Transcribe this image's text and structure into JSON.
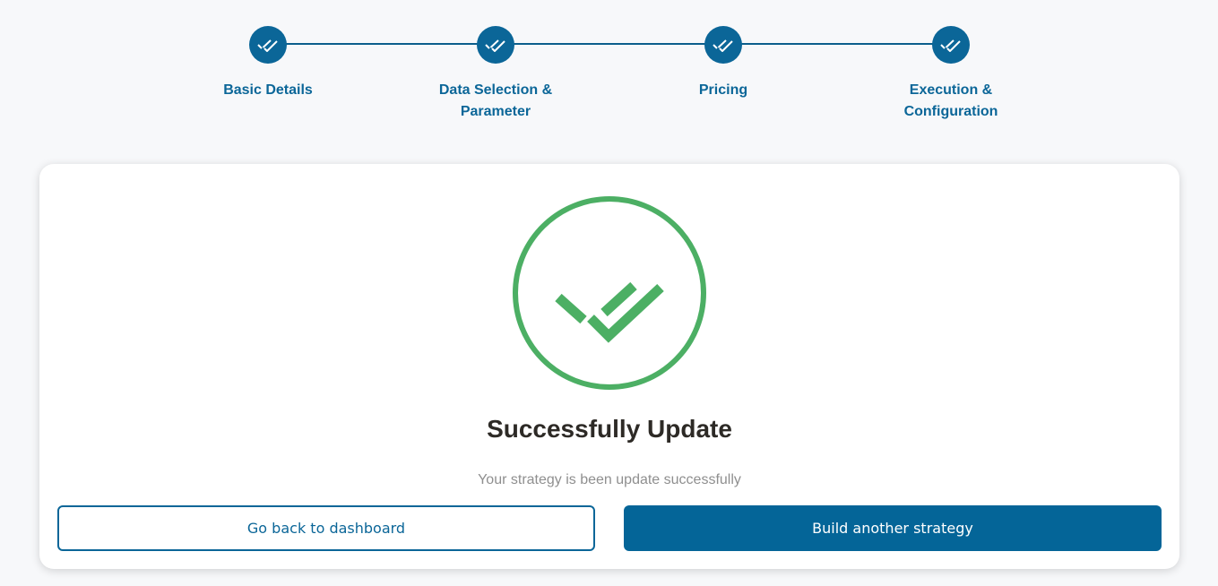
{
  "stepper": {
    "steps": [
      {
        "label_line1": "Basic Details",
        "label_line2": "",
        "status": "completed",
        "icon": "double-check-icon"
      },
      {
        "label_line1": "Data Selection &",
        "label_line2": "Parameter",
        "status": "completed",
        "icon": "double-check-icon"
      },
      {
        "label_line1": "Pricing",
        "label_line2": "",
        "status": "completed",
        "icon": "double-check-icon"
      },
      {
        "label_line1": "Execution &",
        "label_line2": "Configuration",
        "status": "completed",
        "icon": "double-check-icon"
      }
    ]
  },
  "result": {
    "icon": "success-double-check-icon",
    "title": "Successfully Update",
    "message": "Your strategy is been update successfully"
  },
  "actions": {
    "back_label": "Go back to dashboard",
    "build_label": "Build another strategy"
  },
  "colors": {
    "primary": "#0b6698",
    "success": "#4caf64",
    "background": "#f7f8fa"
  }
}
